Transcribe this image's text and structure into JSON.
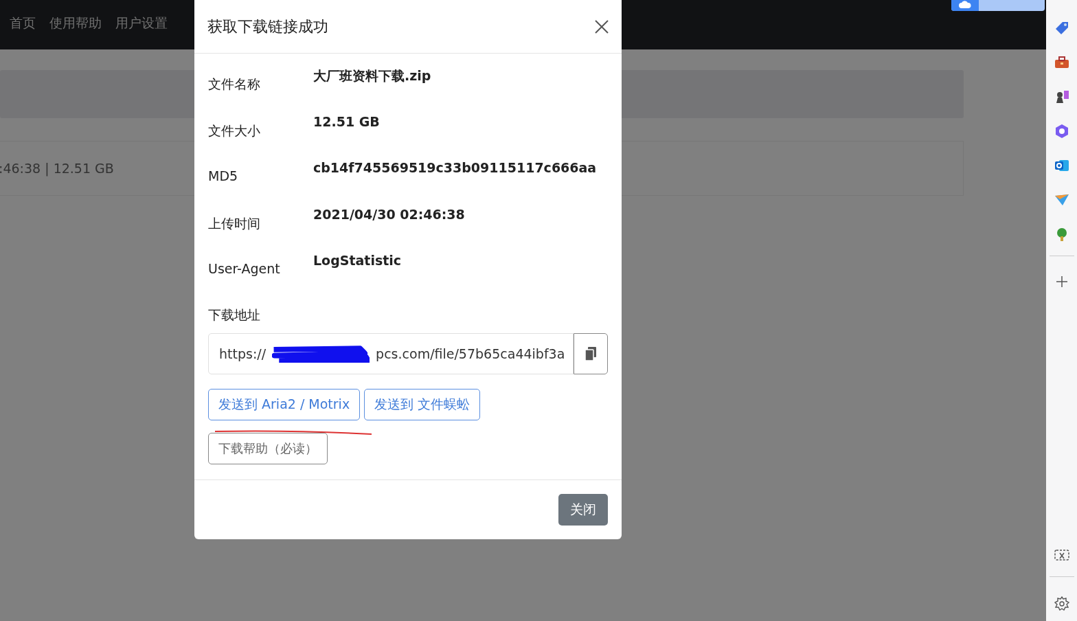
{
  "navbar": {
    "links": [
      "首页",
      "使用帮助",
      "用户设置"
    ]
  },
  "background": {
    "file_row": ":46:38 | 12.51 GB"
  },
  "dialog": {
    "title": "获取下载链接成功",
    "fields": [
      {
        "label": "文件名称",
        "value": "大厂班资料下载.zip"
      },
      {
        "label": "文件大小",
        "value": "12.51 GB"
      },
      {
        "label": "MD5",
        "value": "cb14f745569519c33b09115117c666aa"
      },
      {
        "label": "上传时间",
        "value": "2021/04/30 02:46:38"
      },
      {
        "label": "User-Agent",
        "value": "LogStatistic"
      }
    ],
    "download": {
      "label": "下载地址",
      "url_start": "https://",
      "url_end": "pcs.com/file/57b65ca44ibf3a"
    },
    "send_buttons": [
      "发送到 Aria2 / Motrix",
      "发送到 文件蜈蚣"
    ],
    "help_button": "下载帮助（必读）",
    "close_button": "关闭"
  }
}
